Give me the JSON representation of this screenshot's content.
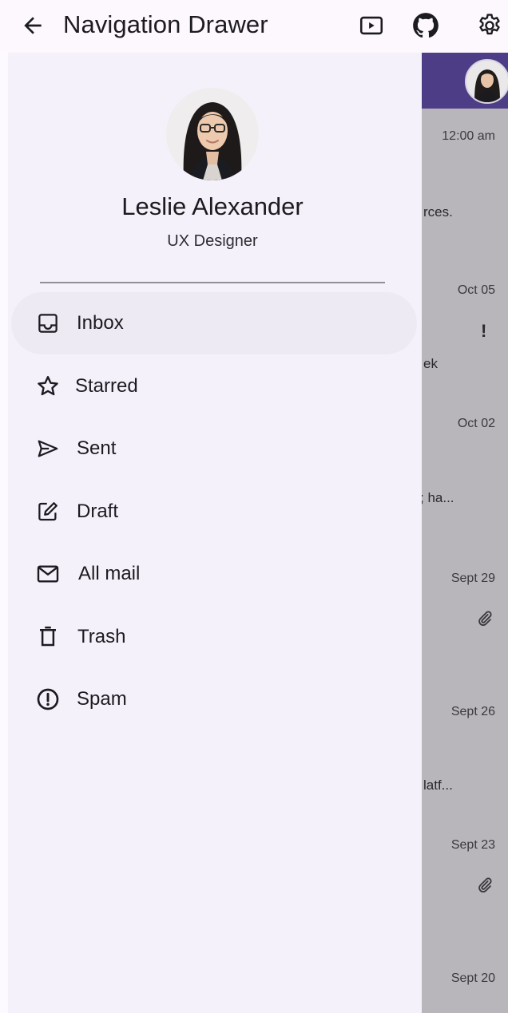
{
  "app_bar": {
    "title": "Navigation Drawer",
    "back_icon": "arrow-back-icon",
    "actions": [
      "video-play-icon",
      "github-icon",
      "settings-icon"
    ]
  },
  "drawer": {
    "profile": {
      "name": "Leslie Alexander",
      "role": "UX Designer",
      "avatar": "avatar-photo"
    },
    "items": [
      {
        "label": "Inbox",
        "icon": "inbox-icon",
        "selected": true
      },
      {
        "label": "Starred",
        "icon": "star-icon",
        "selected": false
      },
      {
        "label": "Sent",
        "icon": "send-icon",
        "selected": false
      },
      {
        "label": "Draft",
        "icon": "edit-icon",
        "selected": false
      },
      {
        "label": "All mail",
        "icon": "mail-icon",
        "selected": false
      },
      {
        "label": "Trash",
        "icon": "trash-icon",
        "selected": false
      },
      {
        "label": "Spam",
        "icon": "report-icon",
        "selected": false
      }
    ]
  },
  "background_list": {
    "header_color": "#4d3d86",
    "scrim_color": "#b8b5bb",
    "dates": [
      "12:00 am",
      "Oct 05",
      "Oct 02",
      "Sept 29",
      "Sept 26",
      "Sept 23",
      "Sept 20"
    ],
    "snippets": [
      "rces.",
      "ek",
      "; ha...",
      "latf..."
    ],
    "markers": [
      "!",
      "attachment-icon",
      "attachment-icon"
    ]
  },
  "colors": {
    "drawer_bg": "#f5f1fa",
    "selected_item_bg": "#eeeaf3",
    "accent": "#4d3d86"
  }
}
